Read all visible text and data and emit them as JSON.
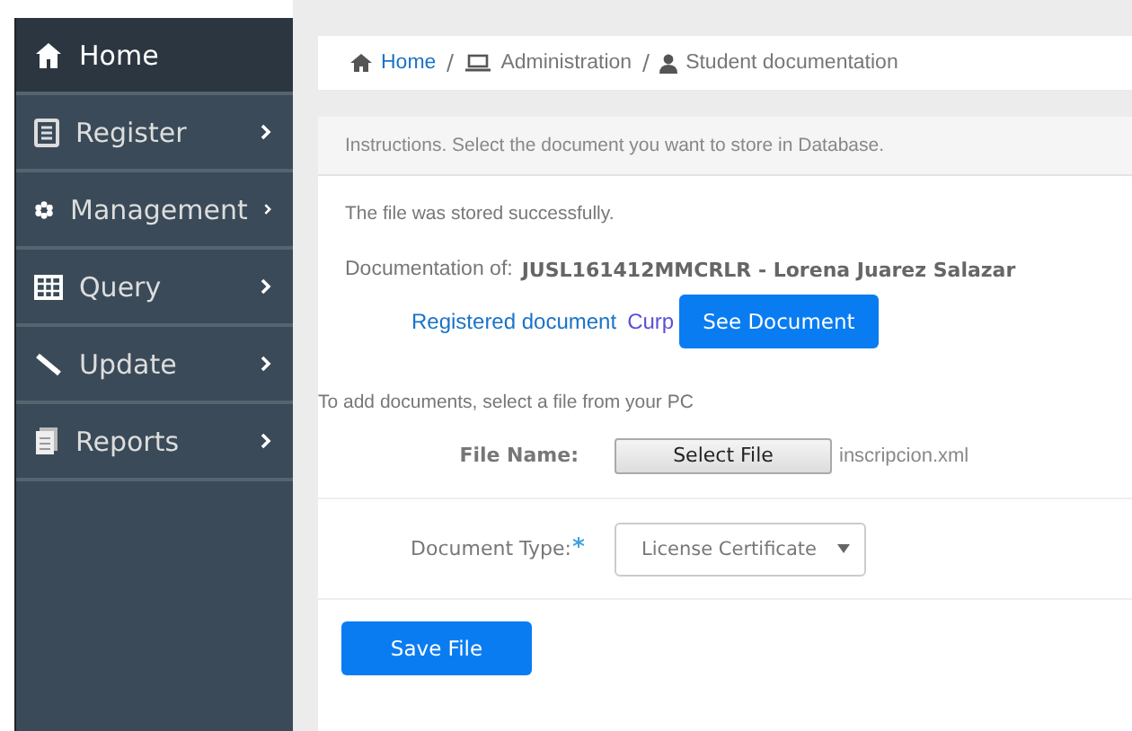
{
  "sidebar": {
    "items": [
      {
        "label": "Home",
        "selected": true,
        "has_submenu": false
      },
      {
        "label": "Register",
        "selected": false,
        "has_submenu": true
      },
      {
        "label": "Management",
        "selected": false,
        "has_submenu": true
      },
      {
        "label": "Query",
        "selected": false,
        "has_submenu": true
      },
      {
        "label": "Update",
        "selected": false,
        "has_submenu": true
      },
      {
        "label": "Reports",
        "selected": false,
        "has_submenu": true
      }
    ]
  },
  "breadcrumb": [
    {
      "label": "Home",
      "link": true
    },
    {
      "label": "Administration",
      "link": false
    },
    {
      "label": "Student documentation",
      "link": false
    }
  ],
  "panel": {
    "instructions": "Instructions. Select the document you want to store in Database.",
    "message": "The file was stored successfully.",
    "documentation_label": "Documentation of:",
    "documentation_value": "JUSL161412MMCRLR - Lorena Juarez Salazar",
    "registered_label": "Registered document",
    "registered_link": "Curp",
    "see_button": "See Document",
    "add_hint": "To add documents, select a file from your PC",
    "file_label": "File Name:",
    "file_button": "Select File",
    "file_value": "inscripcion.xml",
    "type_label": "Document Type:",
    "type_required": true,
    "type_value": "License Certificate",
    "save_button": "Save File"
  }
}
